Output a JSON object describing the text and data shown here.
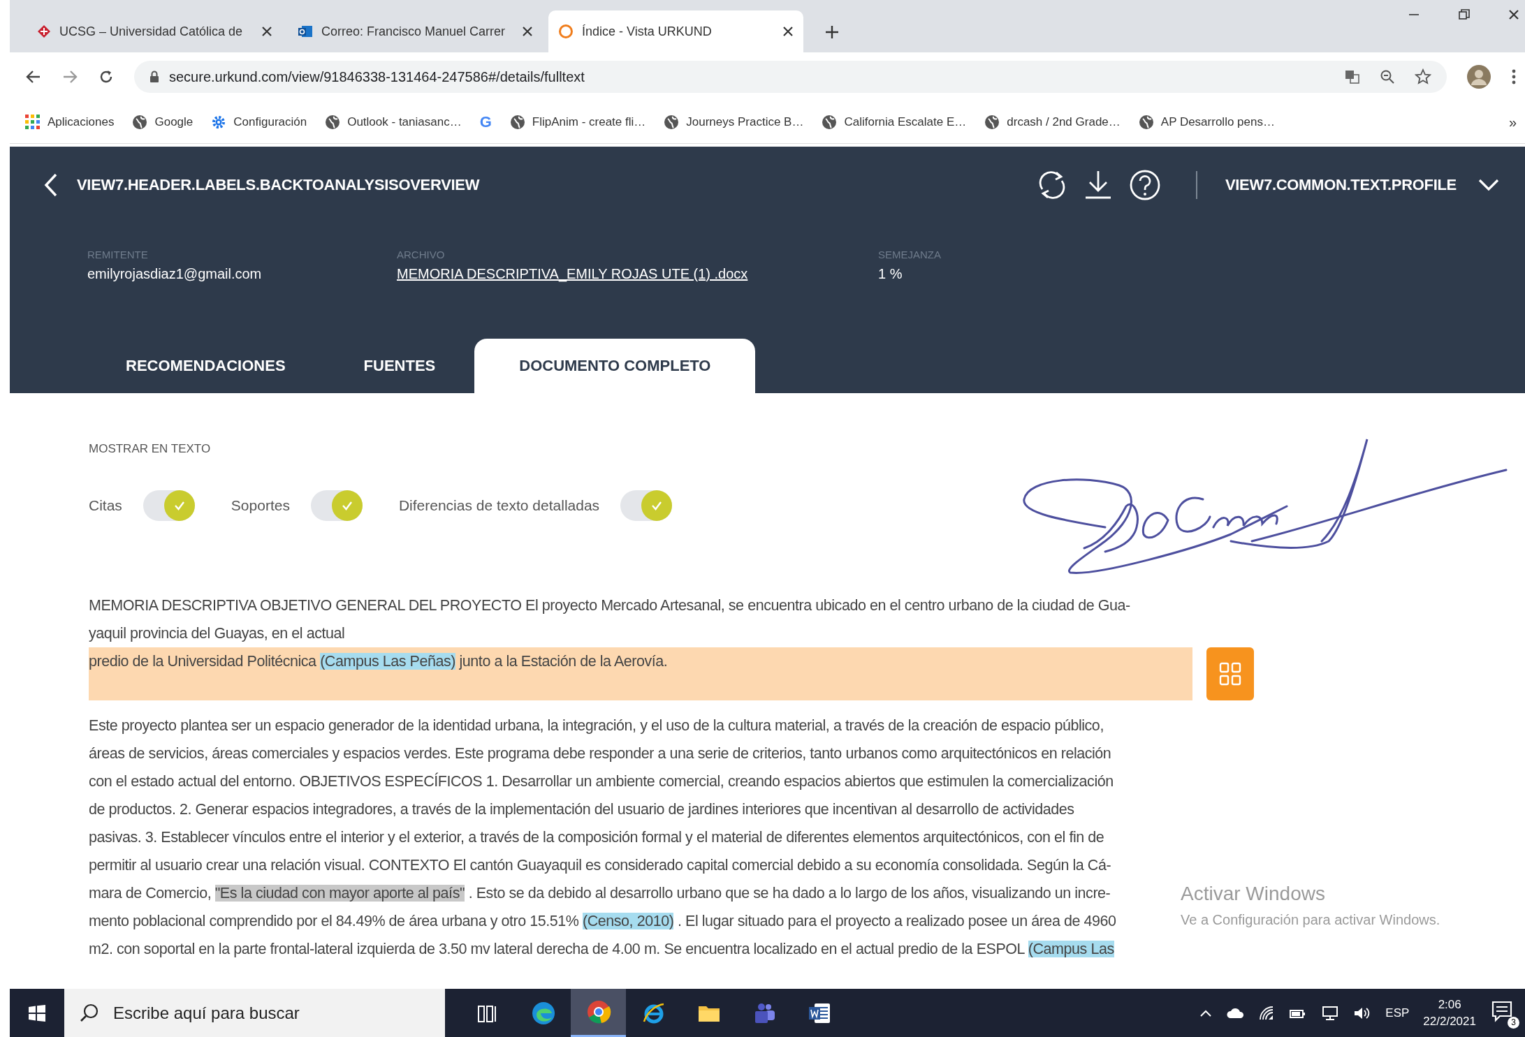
{
  "browser": {
    "tabs": [
      {
        "title": "UCSG – Universidad Católica de",
        "kind": "ucsg",
        "selected": false
      },
      {
        "title": "Correo: Francisco Manuel Carrer",
        "kind": "mail",
        "selected": false
      },
      {
        "title": "Índice - Vista URKUND",
        "kind": "urkund",
        "selected": true
      }
    ],
    "url": "secure.urkund.com/view/91846338-131464-247586#/details/fulltext",
    "bookmarks": [
      {
        "label": "Aplicaciones",
        "kind": "apps"
      },
      {
        "label": "Google",
        "kind": "globe"
      },
      {
        "label": "Configuración",
        "kind": "gear"
      },
      {
        "label": "Outlook - taniasanc…",
        "kind": "globe"
      },
      {
        "label": "G",
        "kind": "letter"
      },
      {
        "label": "FlipAnim - create fli…",
        "kind": "globe"
      },
      {
        "label": "Journeys Practice B…",
        "kind": "globe"
      },
      {
        "label": "California Escalate E…",
        "kind": "globe"
      },
      {
        "label": "drcash / 2nd Grade…",
        "kind": "globe"
      },
      {
        "label": "AP Desarrollo pens…",
        "kind": "globe"
      }
    ],
    "more_bookmarks": "»"
  },
  "header": {
    "back_label": "VIEW7.HEADER.LABELS.BACKTOANALYSISOVERVIEW",
    "profile_label": "VIEW7.COMMON.TEXT.PROFILE",
    "meta": [
      {
        "label": "REMITENTE",
        "value": "emilyrojasdiaz1@gmail.com",
        "kind": "text"
      },
      {
        "label": "ARCHIVO",
        "value": "MEMORIA DESCRIPTIVA_EMILY ROJAS UTE (1) .docx",
        "kind": "link"
      },
      {
        "label": "SEMEJANZA",
        "value": "1 %",
        "kind": "text"
      }
    ],
    "tabs": [
      {
        "label": "RECOMENDACIONES",
        "selected": false
      },
      {
        "label": "FUENTES",
        "selected": false
      },
      {
        "label": "DOCUMENTO COMPLETO",
        "selected": true
      }
    ]
  },
  "show_in_text": {
    "title": "MOSTRAR EN TEXTO",
    "toggles": [
      {
        "label": "Citas",
        "on": true
      },
      {
        "label": "Soportes",
        "on": true
      },
      {
        "label": "Diferencias de texto detalladas",
        "on": true
      }
    ]
  },
  "document": {
    "paragraphs": [
      {
        "kind": "plain",
        "lines": [
          [
            {
              "text": "MEMORIA DESCRIPTIVA OBJETIVO GENERAL DEL PROYECTO El proyecto Mercado Artesanal, se encuentra ubicado en el centro urbano de la ciudad de Gua-"
            }
          ],
          [
            {
              "text": "yaquil provincia del Guayas, en el actual"
            }
          ]
        ]
      },
      {
        "kind": "match",
        "lines": [
          [
            {
              "text": "predio de la Universidad Politécnica "
            },
            {
              "text": "(Campus Las Peñas)",
              "kind": "source"
            },
            {
              "text": " junto a la Estación de la Aerovía."
            }
          ]
        ]
      },
      {
        "kind": "plain",
        "lines": [
          [
            {
              "text": "Este proyecto plantea ser un espacio generador de la identidad urbana, la integración, y el uso de la cultura material, a través de la creación de espacio público,"
            }
          ],
          [
            {
              "text": "áreas de servicios, áreas comerciales y espacios verdes. Este programa debe responder a una serie de criterios, tanto urbanos como arquitectónicos en relación"
            }
          ],
          [
            {
              "text": "con el estado actual del entorno. OBJETIVOS ESPECÍFICOS 1. Desarrollar un ambiente comercial, creando espacios abiertos que estimulen la comercialización"
            }
          ],
          [
            {
              "text": "de productos. 2. Generar espacios integradores, a través de la implementación del usuario de jardines interiores que incentivan al desarrollo de actividades"
            }
          ],
          [
            {
              "text": "pasivas. 3. Establecer vínculos entre el interior y el exterior, a través de la composición formal y el material de diferentes elementos arquitectónicos, con el fin de"
            }
          ],
          [
            {
              "text": "permitir al usuario crear una relación visual. CONTEXTO El cantón Guayaquil es considerado capital comercial debido a su economía consolidada. Según la Cá-"
            }
          ],
          [
            {
              "text": "mara de Comercio, "
            },
            {
              "text": "\"Es la ciudad con mayor aporte al país\"",
              "kind": "quote"
            },
            {
              "text": " . Esto se da debido al desarrollo urbano que se ha dado a lo largo de los años, visualizando un incre-"
            }
          ],
          [
            {
              "text": "mento poblacional comprendido por el 84.49% de área urbana y otro 15.51% "
            },
            {
              "text": "(Censo, 2010)",
              "kind": "source"
            },
            {
              "text": " . El lugar situado para el proyecto a realizado posee un área de 4960"
            }
          ],
          [
            {
              "text": "m2. con soportal en la parte frontal-lateral izquierda de 3.50 mv lateral derecha de 4.00 m. Se encuentra localizado en el actual predio de la ESPOL "
            },
            {
              "text": "(Campus Las",
              "kind": "source"
            }
          ]
        ]
      }
    ]
  },
  "activation_notice": {
    "title": "Activar Windows",
    "subtitle": "Ve a Configuración para activar Windows."
  },
  "taskbar": {
    "search_placeholder": "Escribe aquí para buscar",
    "apps": [
      {
        "kind": "taskview",
        "active": false
      },
      {
        "kind": "edge",
        "active": false
      },
      {
        "kind": "chrome",
        "active": true
      },
      {
        "kind": "ie",
        "active": false
      },
      {
        "kind": "folder",
        "active": false
      },
      {
        "kind": "teams",
        "active": false
      },
      {
        "kind": "word",
        "active": false
      }
    ],
    "language": "ESP",
    "time": "2:06",
    "date": "22/2/2021",
    "notifications": "3"
  }
}
